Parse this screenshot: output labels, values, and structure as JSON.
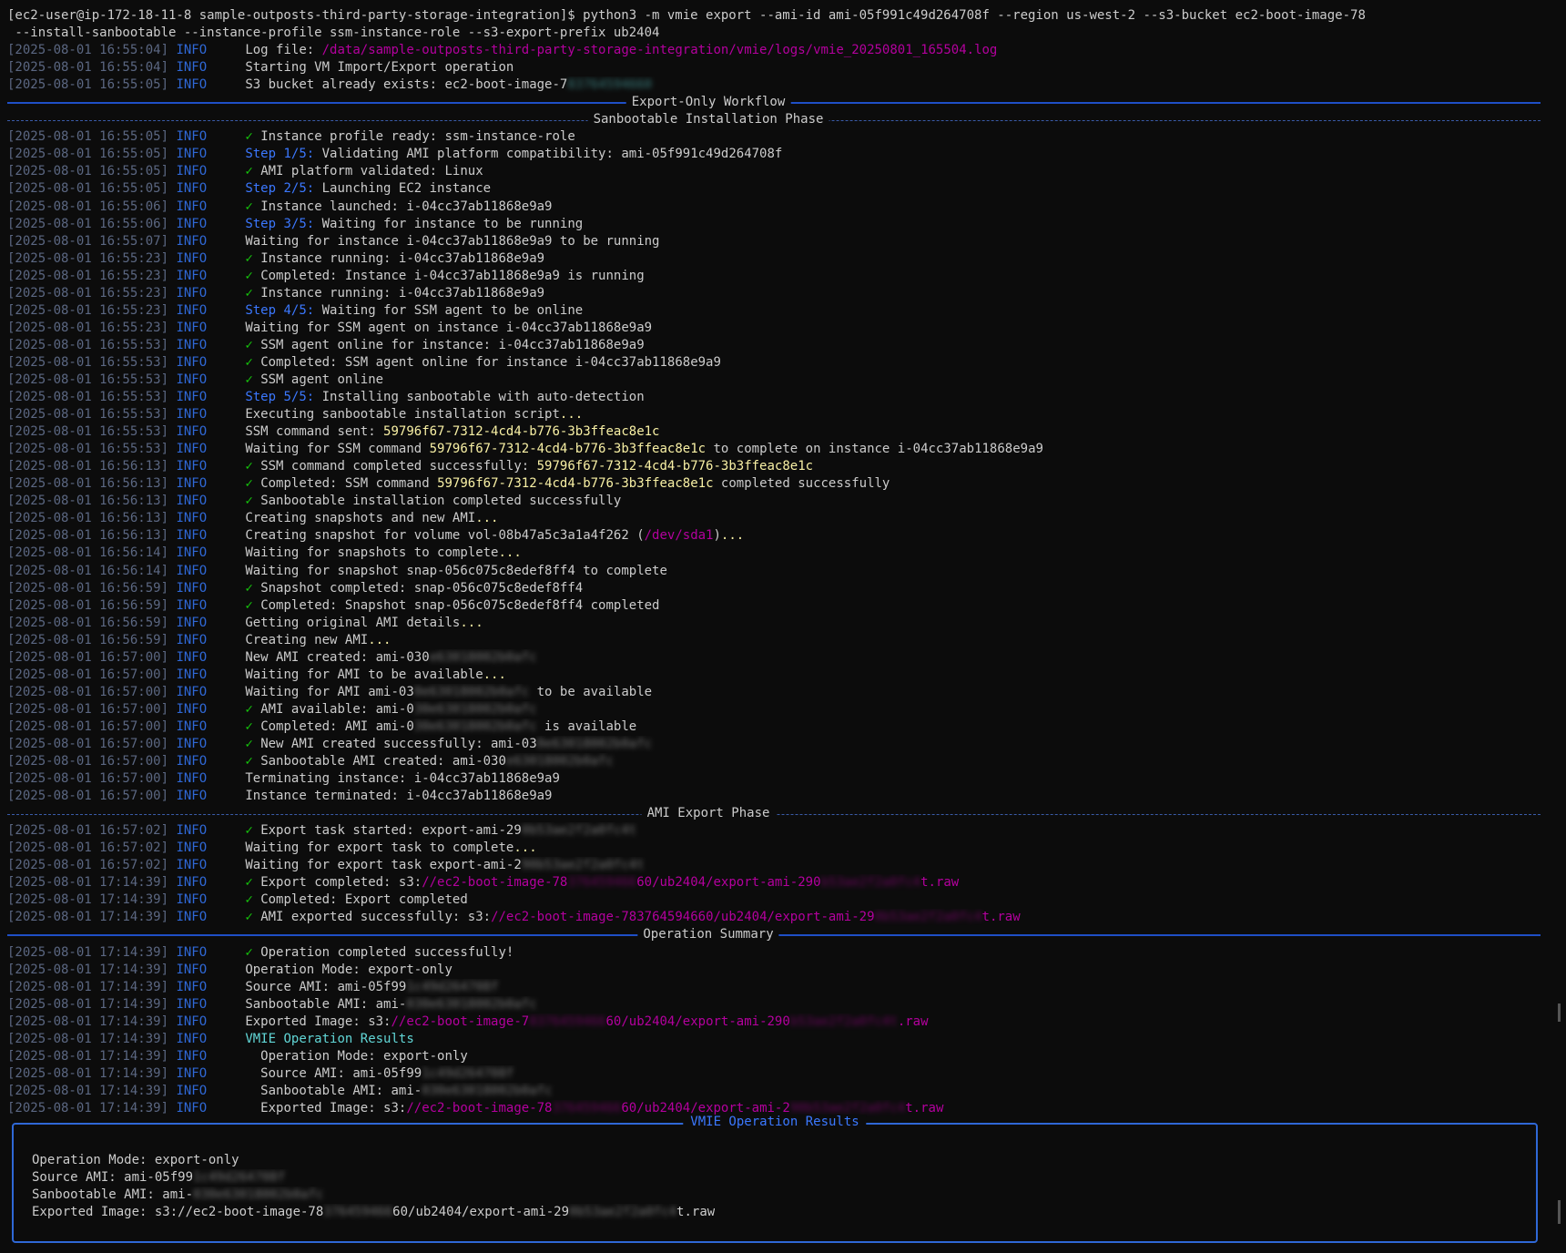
{
  "command": {
    "prompt": "[ec2-user@ip-172-18-11-8 sample-outposts-third-party-storage-integration]$ python3 -m vmie export --ami-id ami-05f991c49d264708f --region us-west-2 --s3-bucket ec2-boot-image-78",
    "continuation": " --install-sanbootable --instance-profile ssm-instance-role --s3-export-prefix ub2404"
  },
  "lines": [
    {
      "ts": "[2025-08-01 16:55:04]",
      "lvl": "INFO",
      "segs": [
        {
          "t": "Log file: "
        },
        {
          "t": "/data/sample-outposts-third-party-storage-integration/vmie/logs/vmie_20250801_165504.log",
          "c": "mag"
        }
      ]
    },
    {
      "ts": "[2025-08-01 16:55:04]",
      "lvl": "INFO",
      "segs": [
        {
          "t": "Starting VM Import/Export operation"
        }
      ]
    },
    {
      "ts": "[2025-08-01 16:55:05]",
      "lvl": "INFO",
      "segs": [
        {
          "t": "S3 bucket already exists: ec2-boot-image-7"
        },
        {
          "t": "83764594660",
          "c": "cyan",
          "blur": true
        }
      ]
    },
    {
      "rule": "solid",
      "title": "Export-Only Workflow"
    },
    {
      "rule": "dash",
      "title": "Sanbootable Installation Phase"
    },
    {
      "ts": "[2025-08-01 16:55:05]",
      "lvl": "INFO",
      "segs": [
        {
          "t": "✓ ",
          "c": "ok"
        },
        {
          "t": "Instance profile ready: ssm-instance-role"
        }
      ]
    },
    {
      "ts": "[2025-08-01 16:55:05]",
      "lvl": "INFO",
      "segs": [
        {
          "t": "Step 1/5:",
          "c": "step"
        },
        {
          "t": " Validating AMI platform compatibility: ami-05f991c49d264708f"
        }
      ]
    },
    {
      "ts": "[2025-08-01 16:55:05]",
      "lvl": "INFO",
      "segs": [
        {
          "t": "✓ ",
          "c": "ok"
        },
        {
          "t": "AMI platform validated: Linux"
        }
      ]
    },
    {
      "ts": "[2025-08-01 16:55:05]",
      "lvl": "INFO",
      "segs": [
        {
          "t": "Step 2/5:",
          "c": "step"
        },
        {
          "t": " Launching EC2 instance"
        }
      ]
    },
    {
      "ts": "[2025-08-01 16:55:06]",
      "lvl": "INFO",
      "segs": [
        {
          "t": "✓ ",
          "c": "ok"
        },
        {
          "t": "Instance launched: i-04cc37ab11868e9a9"
        }
      ]
    },
    {
      "ts": "[2025-08-01 16:55:06]",
      "lvl": "INFO",
      "segs": [
        {
          "t": "Step 3/5:",
          "c": "step"
        },
        {
          "t": " Waiting for instance to be running"
        }
      ]
    },
    {
      "ts": "[2025-08-01 16:55:07]",
      "lvl": "INFO",
      "segs": [
        {
          "t": "Waiting for instance i-04cc37ab11868e9a9 to be running"
        }
      ]
    },
    {
      "ts": "[2025-08-01 16:55:23]",
      "lvl": "INFO",
      "segs": [
        {
          "t": "✓ ",
          "c": "ok"
        },
        {
          "t": "Instance running: i-04cc37ab11868e9a9"
        }
      ]
    },
    {
      "ts": "[2025-08-01 16:55:23]",
      "lvl": "INFO",
      "segs": [
        {
          "t": "✓ ",
          "c": "ok"
        },
        {
          "t": "Completed: Instance i-04cc37ab11868e9a9 is running"
        }
      ]
    },
    {
      "ts": "[2025-08-01 16:55:23]",
      "lvl": "INFO",
      "segs": [
        {
          "t": "✓ ",
          "c": "ok"
        },
        {
          "t": "Instance running: i-04cc37ab11868e9a9"
        }
      ]
    },
    {
      "ts": "[2025-08-01 16:55:23]",
      "lvl": "INFO",
      "segs": [
        {
          "t": "Step 4/5:",
          "c": "step"
        },
        {
          "t": " Waiting for SSM agent to be online"
        }
      ]
    },
    {
      "ts": "[2025-08-01 16:55:23]",
      "lvl": "INFO",
      "segs": [
        {
          "t": "Waiting for SSM agent on instance i-04cc37ab11868e9a9"
        }
      ]
    },
    {
      "ts": "[2025-08-01 16:55:53]",
      "lvl": "INFO",
      "segs": [
        {
          "t": "✓ ",
          "c": "ok"
        },
        {
          "t": "SSM agent online for instance: i-04cc37ab11868e9a9"
        }
      ]
    },
    {
      "ts": "[2025-08-01 16:55:53]",
      "lvl": "INFO",
      "segs": [
        {
          "t": "✓ ",
          "c": "ok"
        },
        {
          "t": "Completed: SSM agent online for instance i-04cc37ab11868e9a9"
        }
      ]
    },
    {
      "ts": "[2025-08-01 16:55:53]",
      "lvl": "INFO",
      "segs": [
        {
          "t": "✓ ",
          "c": "ok"
        },
        {
          "t": "SSM agent online"
        }
      ]
    },
    {
      "ts": "[2025-08-01 16:55:53]",
      "lvl": "INFO",
      "segs": [
        {
          "t": "Step 5/5:",
          "c": "step"
        },
        {
          "t": " Installing sanbootable with auto-detection"
        }
      ]
    },
    {
      "ts": "[2025-08-01 16:55:53]",
      "lvl": "INFO",
      "segs": [
        {
          "t": "Executing sanbootable installation script"
        },
        {
          "t": "...",
          "c": "dim"
        }
      ]
    },
    {
      "ts": "[2025-08-01 16:55:53]",
      "lvl": "INFO",
      "segs": [
        {
          "t": "SSM command sent: "
        },
        {
          "t": "59796f67-7312-4cd4-b776-3b3ffeac8e1c",
          "c": "yel"
        }
      ]
    },
    {
      "ts": "[2025-08-01 16:55:53]",
      "lvl": "INFO",
      "segs": [
        {
          "t": "Waiting for SSM command "
        },
        {
          "t": "59796f67-7312-4cd4-b776-3b3ffeac8e1c",
          "c": "yel"
        },
        {
          "t": " to complete on instance i-04cc37ab11868e9a9"
        }
      ]
    },
    {
      "ts": "[2025-08-01 16:56:13]",
      "lvl": "INFO",
      "segs": [
        {
          "t": "✓ ",
          "c": "ok"
        },
        {
          "t": "SSM command completed successfully: "
        },
        {
          "t": "59796f67-7312-4cd4-b776-3b3ffeac8e1c",
          "c": "yel"
        }
      ]
    },
    {
      "ts": "[2025-08-01 16:56:13]",
      "lvl": "INFO",
      "segs": [
        {
          "t": "✓ ",
          "c": "ok"
        },
        {
          "t": "Completed: SSM command "
        },
        {
          "t": "59796f67-7312-4cd4-b776-3b3ffeac8e1c",
          "c": "yel"
        },
        {
          "t": " completed successfully"
        }
      ]
    },
    {
      "ts": "[2025-08-01 16:56:13]",
      "lvl": "INFO",
      "segs": [
        {
          "t": "✓ ",
          "c": "ok"
        },
        {
          "t": "Sanbootable installation completed successfully"
        }
      ]
    },
    {
      "ts": "[2025-08-01 16:56:13]",
      "lvl": "INFO",
      "segs": [
        {
          "t": "Creating snapshots and new AMI"
        },
        {
          "t": "...",
          "c": "dim"
        }
      ]
    },
    {
      "ts": "[2025-08-01 16:56:13]",
      "lvl": "INFO",
      "segs": [
        {
          "t": "Creating snapshot for volume vol-08b47a5c3a1a4f262 ("
        },
        {
          "t": "/dev/sda1",
          "c": "mag"
        },
        {
          "t": ")"
        },
        {
          "t": "...",
          "c": "dim"
        }
      ]
    },
    {
      "ts": "[2025-08-01 16:56:14]",
      "lvl": "INFO",
      "segs": [
        {
          "t": "Waiting for snapshots to complete"
        },
        {
          "t": "...",
          "c": "dim"
        }
      ]
    },
    {
      "ts": "[2025-08-01 16:56:14]",
      "lvl": "INFO",
      "segs": [
        {
          "t": "Waiting for snapshot snap-056c075c8edef8ff4 to complete"
        }
      ]
    },
    {
      "ts": "[2025-08-01 16:56:59]",
      "lvl": "INFO",
      "segs": [
        {
          "t": "✓ ",
          "c": "ok"
        },
        {
          "t": "Snapshot completed: snap-056c075c8edef8ff4"
        }
      ]
    },
    {
      "ts": "[2025-08-01 16:56:59]",
      "lvl": "INFO",
      "segs": [
        {
          "t": "✓ ",
          "c": "ok"
        },
        {
          "t": "Completed: Snapshot snap-056c075c8edef8ff4 completed"
        }
      ]
    },
    {
      "ts": "[2025-08-01 16:56:59]",
      "lvl": "INFO",
      "segs": [
        {
          "t": "Getting original AMI details"
        },
        {
          "t": "...",
          "c": "dim"
        }
      ]
    },
    {
      "ts": "[2025-08-01 16:56:59]",
      "lvl": "INFO",
      "segs": [
        {
          "t": "Creating new AMI"
        },
        {
          "t": "...",
          "c": "dim"
        }
      ]
    },
    {
      "ts": "[2025-08-01 16:57:00]",
      "lvl": "INFO",
      "segs": [
        {
          "t": "New AMI created: ami-030"
        },
        {
          "t": "e63018002b0afc",
          "blur": true
        }
      ]
    },
    {
      "ts": "[2025-08-01 16:57:00]",
      "lvl": "INFO",
      "segs": [
        {
          "t": "Waiting for AMI to be available"
        },
        {
          "t": "...",
          "c": "dim"
        }
      ]
    },
    {
      "ts": "[2025-08-01 16:57:00]",
      "lvl": "INFO",
      "segs": [
        {
          "t": "Waiting for AMI ami-03"
        },
        {
          "t": "0e63018002b0afc",
          "blur": true
        },
        {
          "t": " to be available"
        }
      ]
    },
    {
      "ts": "[2025-08-01 16:57:00]",
      "lvl": "INFO",
      "segs": [
        {
          "t": "✓ ",
          "c": "ok"
        },
        {
          "t": "AMI available: ami-0"
        },
        {
          "t": "30e63018002b0afc",
          "blur": true
        }
      ]
    },
    {
      "ts": "[2025-08-01 16:57:00]",
      "lvl": "INFO",
      "segs": [
        {
          "t": "✓ ",
          "c": "ok"
        },
        {
          "t": "Completed: AMI ami-0"
        },
        {
          "t": "30e63018002b0afc",
          "blur": true
        },
        {
          "t": " is available"
        }
      ]
    },
    {
      "ts": "[2025-08-01 16:57:00]",
      "lvl": "INFO",
      "segs": [
        {
          "t": "✓ ",
          "c": "ok"
        },
        {
          "t": "New AMI created successfully: ami-03"
        },
        {
          "t": "0e63018002b0afc",
          "blur": true
        }
      ]
    },
    {
      "ts": "[2025-08-01 16:57:00]",
      "lvl": "INFO",
      "segs": [
        {
          "t": "✓ ",
          "c": "ok"
        },
        {
          "t": "Sanbootable AMI created: ami-030"
        },
        {
          "t": "e63018002b0afc",
          "blur": true
        }
      ]
    },
    {
      "ts": "[2025-08-01 16:57:00]",
      "lvl": "INFO",
      "segs": [
        {
          "t": "Terminating instance: i-04cc37ab11868e9a9"
        }
      ]
    },
    {
      "ts": "[2025-08-01 16:57:00]",
      "lvl": "INFO",
      "segs": [
        {
          "t": "Instance terminated: i-04cc37ab11868e9a9"
        }
      ]
    },
    {
      "rule": "dash",
      "title": "AMI Export Phase"
    },
    {
      "ts": "[2025-08-01 16:57:02]",
      "lvl": "INFO",
      "segs": [
        {
          "t": "✓ ",
          "c": "ok"
        },
        {
          "t": "Export task started: export-ami-29"
        },
        {
          "t": "0b53ae2f2a0fc4t",
          "blur": true
        }
      ]
    },
    {
      "ts": "[2025-08-01 16:57:02]",
      "lvl": "INFO",
      "segs": [
        {
          "t": "Waiting for export task to complete"
        },
        {
          "t": "...",
          "c": "dim"
        }
      ]
    },
    {
      "ts": "[2025-08-01 16:57:02]",
      "lvl": "INFO",
      "segs": [
        {
          "t": "Waiting for export task export-ami-2"
        },
        {
          "t": "90b53ae2f2a0fc4t",
          "blur": true
        }
      ]
    },
    {
      "ts": "[2025-08-01 17:14:39]",
      "lvl": "INFO",
      "segs": [
        {
          "t": "✓ ",
          "c": "ok"
        },
        {
          "t": "Export completed: s3:"
        },
        {
          "t": "//ec2-boot-image-78",
          "c": "mag"
        },
        {
          "t": "376459466",
          "c": "mag",
          "blur": true
        },
        {
          "t": "60/ub2404/export-ami-290",
          "c": "mag"
        },
        {
          "t": "b53ae2f2a0fc4",
          "c": "mag",
          "blur": true
        },
        {
          "t": "t.raw",
          "c": "mag"
        }
      ]
    },
    {
      "ts": "[2025-08-01 17:14:39]",
      "lvl": "INFO",
      "segs": [
        {
          "t": "✓ ",
          "c": "ok"
        },
        {
          "t": "Completed: Export completed"
        }
      ]
    },
    {
      "ts": "[2025-08-01 17:14:39]",
      "lvl": "INFO",
      "segs": [
        {
          "t": "✓ ",
          "c": "ok"
        },
        {
          "t": "AMI exported successfully: s3:"
        },
        {
          "t": "//ec2-boot-image-783764594660/ub2404/export-ami-29",
          "c": "mag"
        },
        {
          "t": "0b53ae2f2a0fc4",
          "c": "mag",
          "blur": true
        },
        {
          "t": "t.raw",
          "c": "mag"
        }
      ]
    },
    {
      "rule": "solid",
      "title": "Operation Summary"
    },
    {
      "ts": "[2025-08-01 17:14:39]",
      "lvl": "INFO",
      "segs": [
        {
          "t": "✓ ",
          "c": "ok"
        },
        {
          "t": "Operation completed successfully!"
        }
      ]
    },
    {
      "ts": "[2025-08-01 17:14:39]",
      "lvl": "INFO",
      "segs": [
        {
          "t": "Operation Mode: export-only"
        }
      ]
    },
    {
      "ts": "[2025-08-01 17:14:39]",
      "lvl": "INFO",
      "segs": [
        {
          "t": "Source AMI: ami-05f99"
        },
        {
          "t": "1c49d264708f",
          "blur": true
        }
      ]
    },
    {
      "ts": "[2025-08-01 17:14:39]",
      "lvl": "INFO",
      "segs": [
        {
          "t": "Sanbootable AMI: ami-"
        },
        {
          "t": "030e63018002b0afc",
          "blur": true
        }
      ]
    },
    {
      "ts": "[2025-08-01 17:14:39]",
      "lvl": "INFO",
      "segs": [
        {
          "t": "Exported Image: s3:"
        },
        {
          "t": "//ec2-boot-image-7",
          "c": "mag"
        },
        {
          "t": "8376459466",
          "c": "mag",
          "blur": true
        },
        {
          "t": "60/ub2404/export-ami-290",
          "c": "mag"
        },
        {
          "t": "b53ae2f2a0fc4t",
          "c": "mag",
          "blur": true
        },
        {
          "t": ".raw",
          "c": "mag"
        }
      ]
    },
    {
      "ts": "[2025-08-01 17:14:39]",
      "lvl": "INFO",
      "segs": [
        {
          "t": "VMIE Operation Results",
          "c": "cyan"
        }
      ]
    },
    {
      "ts": "[2025-08-01 17:14:39]",
      "lvl": "INFO",
      "segs": [
        {
          "t": "  Operation Mode: export-only"
        }
      ]
    },
    {
      "ts": "[2025-08-01 17:14:39]",
      "lvl": "INFO",
      "segs": [
        {
          "t": "  Source AMI: ami-05f99"
        },
        {
          "t": "1c49d264708f",
          "blur": true
        }
      ]
    },
    {
      "ts": "[2025-08-01 17:14:39]",
      "lvl": "INFO",
      "segs": [
        {
          "t": "  Sanbootable AMI: ami-"
        },
        {
          "t": "030e63018002b0afc",
          "blur": true
        }
      ]
    },
    {
      "ts": "[2025-08-01 17:14:39]",
      "lvl": "INFO",
      "segs": [
        {
          "t": "  Exported Image: s3:"
        },
        {
          "t": "//ec2-boot-image-78",
          "c": "mag"
        },
        {
          "t": "376459466",
          "c": "mag",
          "blur": true
        },
        {
          "t": "60/ub2404/export-ami-2",
          "c": "mag"
        },
        {
          "t": "90b53ae2f2a0fc4",
          "c": "mag",
          "blur": true
        },
        {
          "t": "t.raw",
          "c": "mag"
        }
      ]
    }
  ],
  "panel": {
    "title": "VMIE Operation Results",
    "rows": [
      {
        "segs": [
          {
            "t": "Operation Mode: export-only"
          }
        ]
      },
      {
        "segs": [
          {
            "t": "Source AMI: ami-05f99"
          },
          {
            "t": "1c49d264708f",
            "blur": true
          }
        ]
      },
      {
        "segs": [
          {
            "t": "Sanbootable AMI: ami-"
          },
          {
            "t": "030e63018002b0afc",
            "blur": true
          }
        ]
      },
      {
        "segs": [
          {
            "t": "Exported Image: s3://ec2-boot-image-78"
          },
          {
            "t": "376459466",
            "blur": true
          },
          {
            "t": "60/ub2404/export-ami-29"
          },
          {
            "t": "0b53ae2f2a0fc4",
            "blur": true
          },
          {
            "t": "t.raw"
          }
        ]
      }
    ]
  },
  "colors": {
    "background": "#0c0c0c",
    "foreground": "#cccccc",
    "timestamp": "#5b6782",
    "level": "#2f68d6",
    "check": "#16c60c",
    "step": "#3b78ff",
    "path": "#b4009e",
    "uuid": "#f9f1a5",
    "rule": "#1f4fc6"
  }
}
